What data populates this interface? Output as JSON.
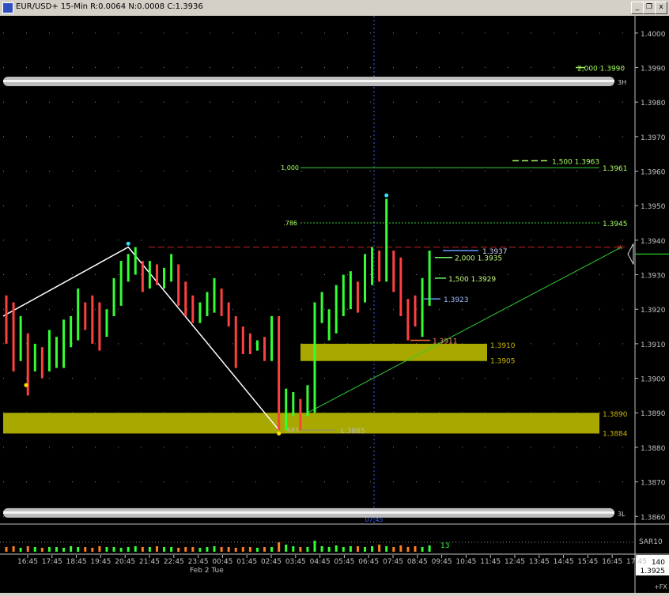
{
  "window": {
    "title": "EUR/USD+ 15-Min R:0.0064 N:0.0008 C:1.3936",
    "buttons": {
      "minimize": "_",
      "restore": "❐",
      "close": "x"
    }
  },
  "chart_data": {
    "type": "bar",
    "instrument": "EUR/USD+",
    "timeframe": "15-Min",
    "last_price": "1.3936",
    "y_axis": {
      "range": [
        1.3858,
        1.4005
      ],
      "ticks": [
        "1.4000",
        "1.3990",
        "1.3980",
        "1.3970",
        "1.3960",
        "1.3950",
        "1.3940",
        "1.3930",
        "1.3920",
        "1.3910",
        "1.3900",
        "1.3890",
        "1.3880",
        "1.3870",
        "1.3860"
      ]
    },
    "x_axis": {
      "tick_labels": [
        "16:45",
        "17:45",
        "18:45",
        "19:45",
        "20:45",
        "21:45",
        "22:45",
        "23:45",
        "00:45",
        "01:45",
        "02:45",
        "03:45",
        "04:45",
        "05:45",
        "06:45",
        "07:45",
        "08:45",
        "09:45",
        "10:45",
        "11:45",
        "12:45",
        "13:45",
        "14:45",
        "15:45",
        "16:45",
        "17:45"
      ],
      "date_label": "Feb 2 Tue",
      "cursor_label": "07:45"
    },
    "bars": [
      {
        "h": 1.3924,
        "l": 1.391,
        "up": false
      },
      {
        "h": 1.3922,
        "l": 1.3902,
        "up": false
      },
      {
        "h": 1.3918,
        "l": 1.3905,
        "up": true
      },
      {
        "h": 1.3913,
        "l": 1.3895,
        "up": false
      },
      {
        "h": 1.391,
        "l": 1.3902,
        "up": true
      },
      {
        "h": 1.3909,
        "l": 1.39,
        "up": false
      },
      {
        "h": 1.3914,
        "l": 1.3902,
        "up": true
      },
      {
        "h": 1.3912,
        "l": 1.3903,
        "up": true
      },
      {
        "h": 1.3917,
        "l": 1.3903,
        "up": true
      },
      {
        "h": 1.3918,
        "l": 1.3909,
        "up": true
      },
      {
        "h": 1.3926,
        "l": 1.3911,
        "up": true
      },
      {
        "h": 1.3922,
        "l": 1.3914,
        "up": false
      },
      {
        "h": 1.3924,
        "l": 1.391,
        "up": false
      },
      {
        "h": 1.3922,
        "l": 1.3908,
        "up": false
      },
      {
        "h": 1.392,
        "l": 1.3912,
        "up": true
      },
      {
        "h": 1.3929,
        "l": 1.3918,
        "up": true
      },
      {
        "h": 1.3934,
        "l": 1.3921,
        "up": true
      },
      {
        "h": 1.3936,
        "l": 1.3928,
        "up": true
      },
      {
        "h": 1.3938,
        "l": 1.393,
        "up": true
      },
      {
        "h": 1.3934,
        "l": 1.3925,
        "up": false
      },
      {
        "h": 1.3934,
        "l": 1.3926,
        "up": true
      },
      {
        "h": 1.3933,
        "l": 1.3927,
        "up": false
      },
      {
        "h": 1.3932,
        "l": 1.3926,
        "up": true
      },
      {
        "h": 1.3936,
        "l": 1.3928,
        "up": true
      },
      {
        "h": 1.3933,
        "l": 1.3921,
        "up": false
      },
      {
        "h": 1.3928,
        "l": 1.3918,
        "up": false
      },
      {
        "h": 1.3924,
        "l": 1.3916,
        "up": false
      },
      {
        "h": 1.3922,
        "l": 1.3916,
        "up": true
      },
      {
        "h": 1.3925,
        "l": 1.3918,
        "up": true
      },
      {
        "h": 1.3929,
        "l": 1.3919,
        "up": true
      },
      {
        "h": 1.3926,
        "l": 1.3918,
        "up": false
      },
      {
        "h": 1.3922,
        "l": 1.3915,
        "up": false
      },
      {
        "h": 1.3918,
        "l": 1.3903,
        "up": false
      },
      {
        "h": 1.3915,
        "l": 1.3907,
        "up": false
      },
      {
        "h": 1.3913,
        "l": 1.3907,
        "up": false
      },
      {
        "h": 1.3911,
        "l": 1.3908,
        "up": true
      },
      {
        "h": 1.3912,
        "l": 1.3905,
        "up": false
      },
      {
        "h": 1.3918,
        "l": 1.3905,
        "up": true
      },
      {
        "h": 1.3918,
        "l": 1.3885,
        "up": false
      },
      {
        "h": 1.3897,
        "l": 1.3885,
        "up": true
      },
      {
        "h": 1.3896,
        "l": 1.3889,
        "up": true
      },
      {
        "h": 1.3894,
        "l": 1.3885,
        "up": false
      },
      {
        "h": 1.3898,
        "l": 1.3889,
        "up": true
      },
      {
        "h": 1.3922,
        "l": 1.389,
        "up": true
      },
      {
        "h": 1.3925,
        "l": 1.3916,
        "up": true
      },
      {
        "h": 1.392,
        "l": 1.3911,
        "up": true
      },
      {
        "h": 1.3927,
        "l": 1.3913,
        "up": true
      },
      {
        "h": 1.393,
        "l": 1.3918,
        "up": true
      },
      {
        "h": 1.3931,
        "l": 1.392,
        "up": true
      },
      {
        "h": 1.3928,
        "l": 1.3919,
        "up": false
      },
      {
        "h": 1.3936,
        "l": 1.3922,
        "up": true
      },
      {
        "h": 1.3938,
        "l": 1.3927,
        "up": true
      },
      {
        "h": 1.3937,
        "l": 1.3928,
        "up": false
      },
      {
        "h": 1.3952,
        "l": 1.3928,
        "up": true
      },
      {
        "h": 1.3937,
        "l": 1.3925,
        "up": false
      },
      {
        "h": 1.3935,
        "l": 1.3918,
        "up": false
      },
      {
        "h": 1.3923,
        "l": 1.3911,
        "up": false
      },
      {
        "h": 1.3924,
        "l": 1.3915,
        "up": false
      },
      {
        "h": 1.3929,
        "l": 1.3912,
        "up": true
      },
      {
        "h": 1.3937,
        "l": 1.3921,
        "up": true
      }
    ],
    "volume": {
      "label": "13",
      "indicator": "SAR10",
      "values": [
        6,
        7,
        5,
        7,
        6,
        5,
        6,
        6,
        5,
        7,
        6,
        6,
        5,
        7,
        6,
        6,
        5,
        6,
        7,
        6,
        6,
        7,
        6,
        6,
        5,
        6,
        6,
        5,
        6,
        7,
        6,
        6,
        5,
        6,
        6,
        5,
        6,
        6,
        12,
        9,
        7,
        6,
        6,
        14,
        7,
        6,
        8,
        6,
        7,
        7,
        6,
        7,
        9,
        7,
        6,
        8,
        6,
        7,
        6,
        8
      ]
    },
    "bottom_right_readout": [
      "140",
      "1.3925"
    ],
    "fx_label": "+FX",
    "bands": [
      {
        "name": "3H",
        "price": 1.3986
      },
      {
        "name": "3L",
        "price": 1.3861
      }
    ],
    "zones": [
      {
        "top": 1.391,
        "bottom": 1.3905,
        "top_label": "1.3910",
        "bottom_label": "1.3905"
      },
      {
        "top": 1.389,
        "bottom": 1.3884,
        "top_label": "1.3890",
        "bottom_label": "1.3884"
      }
    ],
    "fib_levels": [
      {
        "ratio": "1,000",
        "price": 1.3961,
        "label": "1.3961",
        "style": "solid"
      },
      {
        "ratio": ".786",
        "price": 1.3945,
        "label": "1.3945",
        "style": "dotted"
      },
      {
        "ratio": ".683",
        "price": 1.3885,
        "label": "1.3885",
        "style": "solid"
      }
    ],
    "projections": [
      {
        "text": "2,000  1.3990",
        "price": 1.399
      },
      {
        "text": "1,500  1.3963",
        "price": 1.3963
      },
      {
        "text": "1.3937",
        "price": 1.3937
      },
      {
        "text": "2,000  1.3935",
        "price": 1.3935
      },
      {
        "text": "1,500  1.3929",
        "price": 1.3929
      },
      {
        "text": "1.3923",
        "price": 1.3923
      },
      {
        "text": "1.3911",
        "price": 1.3911
      }
    ],
    "swings": [
      {
        "bar": 0,
        "price": 1.3918
      },
      {
        "bar": 17,
        "price": 1.3938
      },
      {
        "bar": 38,
        "price": 1.3885
      },
      {
        "bar": 42,
        "price": 1.389
      }
    ],
    "resistance_line": {
      "price": 1.3938,
      "marker": "W"
    },
    "trendline": {
      "from_bar": 42,
      "from_price": 1.389,
      "price_end": 1.3938
    },
    "colors": {
      "up": "#33ff33",
      "down": "#ff4040",
      "zone": "#a8a800",
      "fib": "#33cc33",
      "band": "#c8c8c8",
      "resistance": "#cc2222",
      "cursor": "#3b5bff",
      "swing": "#ffffff"
    }
  }
}
